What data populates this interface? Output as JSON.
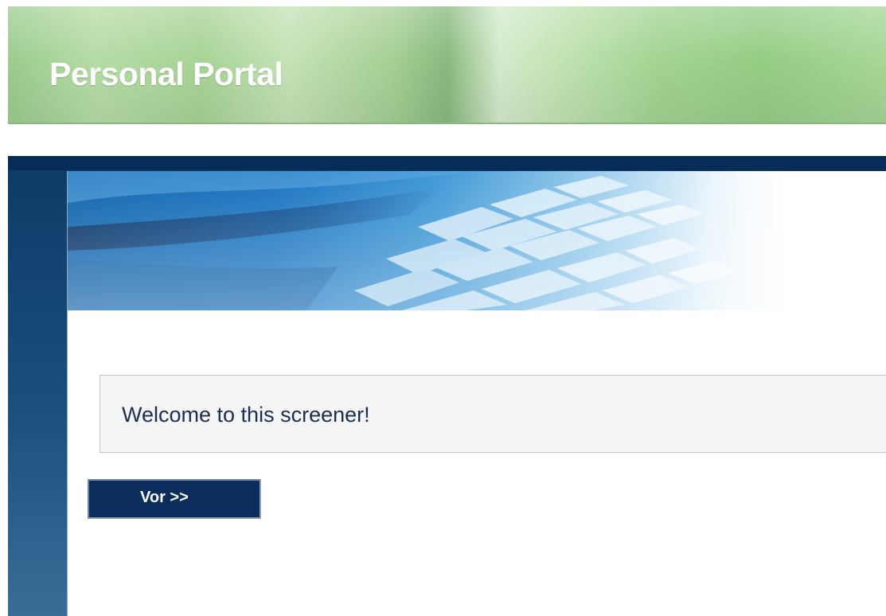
{
  "header": {
    "title": "Personal Portal"
  },
  "welcome": {
    "message": "Welcome to this screener!"
  },
  "navigation": {
    "next_label": "Vor >>"
  },
  "colors": {
    "header_green": "#a8d396",
    "frame_blue": "#0d3a66",
    "button_navy": "#0a2d5e",
    "welcome_text": "#1c2f4f"
  }
}
